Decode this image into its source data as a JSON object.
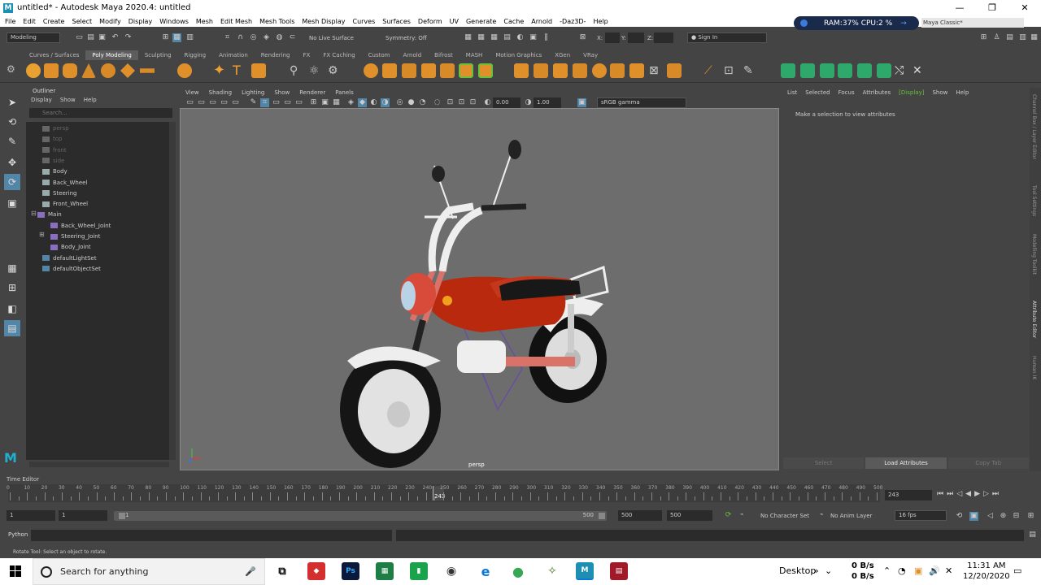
{
  "window": {
    "title": "untitled* - Autodesk Maya 2020.4: untitled",
    "logo": "M"
  },
  "menubar": [
    "File",
    "Edit",
    "Create",
    "Select",
    "Modify",
    "Display",
    "Windows",
    "Mesh",
    "Edit Mesh",
    "Mesh Tools",
    "Mesh Display",
    "Curves",
    "Surfaces",
    "Deform",
    "UV",
    "Generate",
    "Cache",
    "Arnold",
    "-Daz3D-",
    "Help"
  ],
  "monitor": {
    "text": "RAM:37%  CPU:2 %"
  },
  "workspace": "Maya Classic*",
  "statusline": {
    "menuset": "Modeling",
    "live_surface": "No Live Surface",
    "symmetry": "Symmetry: Off",
    "coord_x": "X:",
    "coord_y": "Y:",
    "coord_z": "Z:",
    "sign_in": "Sign In"
  },
  "shelf_tabs": [
    "Curves / Surfaces",
    "Poly Modeling",
    "Sculpting",
    "Rigging",
    "Animation",
    "Rendering",
    "FX",
    "FX Caching",
    "Custom",
    "Arnold",
    "Bifrost",
    "MASH",
    "Motion Graphics",
    "XGen",
    "VRay"
  ],
  "shelf_active": "Poly Modeling",
  "outliner": {
    "title": "Outliner",
    "menu": [
      "Display",
      "Show",
      "Help"
    ],
    "search_placeholder": "Search...",
    "items": [
      {
        "label": "persp",
        "dim": true
      },
      {
        "label": "top",
        "dim": true
      },
      {
        "label": "front",
        "dim": true
      },
      {
        "label": "side",
        "dim": true
      },
      {
        "label": "Body",
        "dim": false
      },
      {
        "label": "Back_Wheel",
        "dim": false
      },
      {
        "label": "Steering",
        "dim": false
      },
      {
        "label": "Front_Wheel",
        "dim": false
      },
      {
        "label": "Main",
        "dim": false
      },
      {
        "label": "Back_Wheel_Joint",
        "dim": false
      },
      {
        "label": "Steering_Joint",
        "dim": false
      },
      {
        "label": "Body_Joint",
        "dim": false
      },
      {
        "label": "defaultLightSet",
        "dim": false
      },
      {
        "label": "defaultObjectSet",
        "dim": false
      }
    ]
  },
  "viewport": {
    "menu": [
      "View",
      "Shading",
      "Lighting",
      "Show",
      "Renderer",
      "Panels"
    ],
    "exposure": "0.00",
    "gamma": "1.00",
    "color_space": "sRGB gamma",
    "camera": "persp"
  },
  "attribute_editor": {
    "menu": [
      "List",
      "Selected",
      "Focus",
      "Attributes",
      "Display",
      "Show",
      "Help"
    ],
    "active_menu": "Display",
    "message": "Make a selection to view attributes",
    "buttons": [
      "Select",
      "Load Attributes",
      "Copy Tab"
    ]
  },
  "side_tabs": [
    "Channel Box / Layer Editor",
    "Tool Settings",
    "Modelling Toolkit",
    "Attribute Editor",
    "Human IK"
  ],
  "time_editor": {
    "label": "Time Editor"
  },
  "timeline": {
    "labels": [
      "0",
      "10",
      "20",
      "30",
      "40",
      "50",
      "60",
      "70",
      "80",
      "90",
      "100",
      "110",
      "120",
      "130",
      "140",
      "150",
      "160",
      "170",
      "180",
      "190",
      "200",
      "210",
      "220",
      "230",
      "240",
      "250",
      "260",
      "270",
      "280",
      "290",
      "300",
      "310",
      "320",
      "330",
      "340",
      "350",
      "360",
      "370",
      "380",
      "390",
      "400",
      "410",
      "420",
      "430",
      "440",
      "450",
      "460",
      "470",
      "480",
      "490",
      "500"
    ],
    "current_frame": "243",
    "current_field": "243"
  },
  "range": {
    "start": "1",
    "playback_start": "1",
    "slider_start": "1",
    "slider_end": "500",
    "playback_end": "500",
    "end": "500",
    "character_set": "No Character Set",
    "anim_layer": "No Anim Layer",
    "fps": "16 fps"
  },
  "python": {
    "label": "Python"
  },
  "helpline": "Rotate Tool: Select an object to rotate.",
  "taskbar": {
    "search": "Search for anything",
    "desktop": "Desktop",
    "net_up": "0 B/s",
    "net_down": "0 B/s",
    "time": "11:31 AM",
    "date": "12/20/2020",
    "apps": [
      {
        "name": "photoshop",
        "label": "Ps",
        "color": "#0b1a3a",
        "fg": "#31a8ff"
      },
      {
        "name": "edge",
        "label": "e",
        "color": "#ffffff",
        "fg": "#0a78d7"
      },
      {
        "name": "chrome",
        "label": "●",
        "color": "#ffffff",
        "fg": "#34a853"
      },
      {
        "name": "maya",
        "label": "M",
        "color": "#1d8fb3",
        "fg": "#ffffff"
      }
    ]
  },
  "colors": {
    "accent": "#5285a6",
    "viewport_bg": "#6d6d6d",
    "active_display": "#67c23a"
  }
}
